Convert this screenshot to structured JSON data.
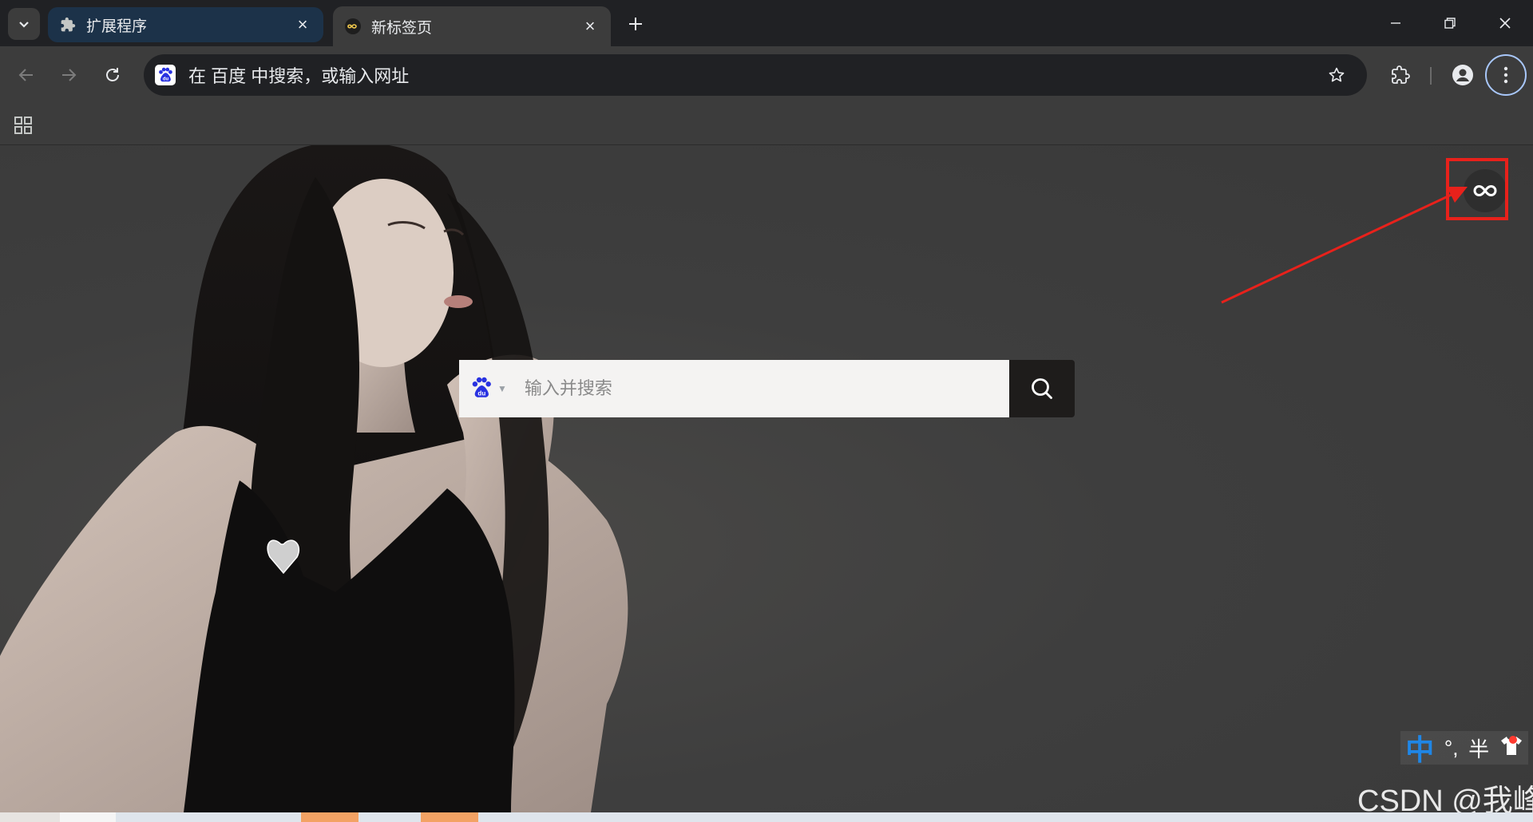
{
  "tabs": [
    {
      "title": "扩展程序",
      "icon": "puzzle-icon",
      "active": false
    },
    {
      "title": "新标签页",
      "icon": "infinity-icon",
      "active": true
    }
  ],
  "omnibox": {
    "engine_icon": "baidu-paw-icon",
    "text": "在 百度 中搜索，或输入网址"
  },
  "search": {
    "engine_icon": "baidu-paw-icon",
    "placeholder": "输入并搜索"
  },
  "ime": {
    "mode": "中",
    "punct": "°,",
    "width": "半"
  },
  "watermark": "CSDN @我峰",
  "colors": {
    "accent_red": "#e8211b",
    "tab_active": "#3c3c3c",
    "tab_inactive": "#1c3249",
    "baidu_blue": "#2932e1"
  }
}
